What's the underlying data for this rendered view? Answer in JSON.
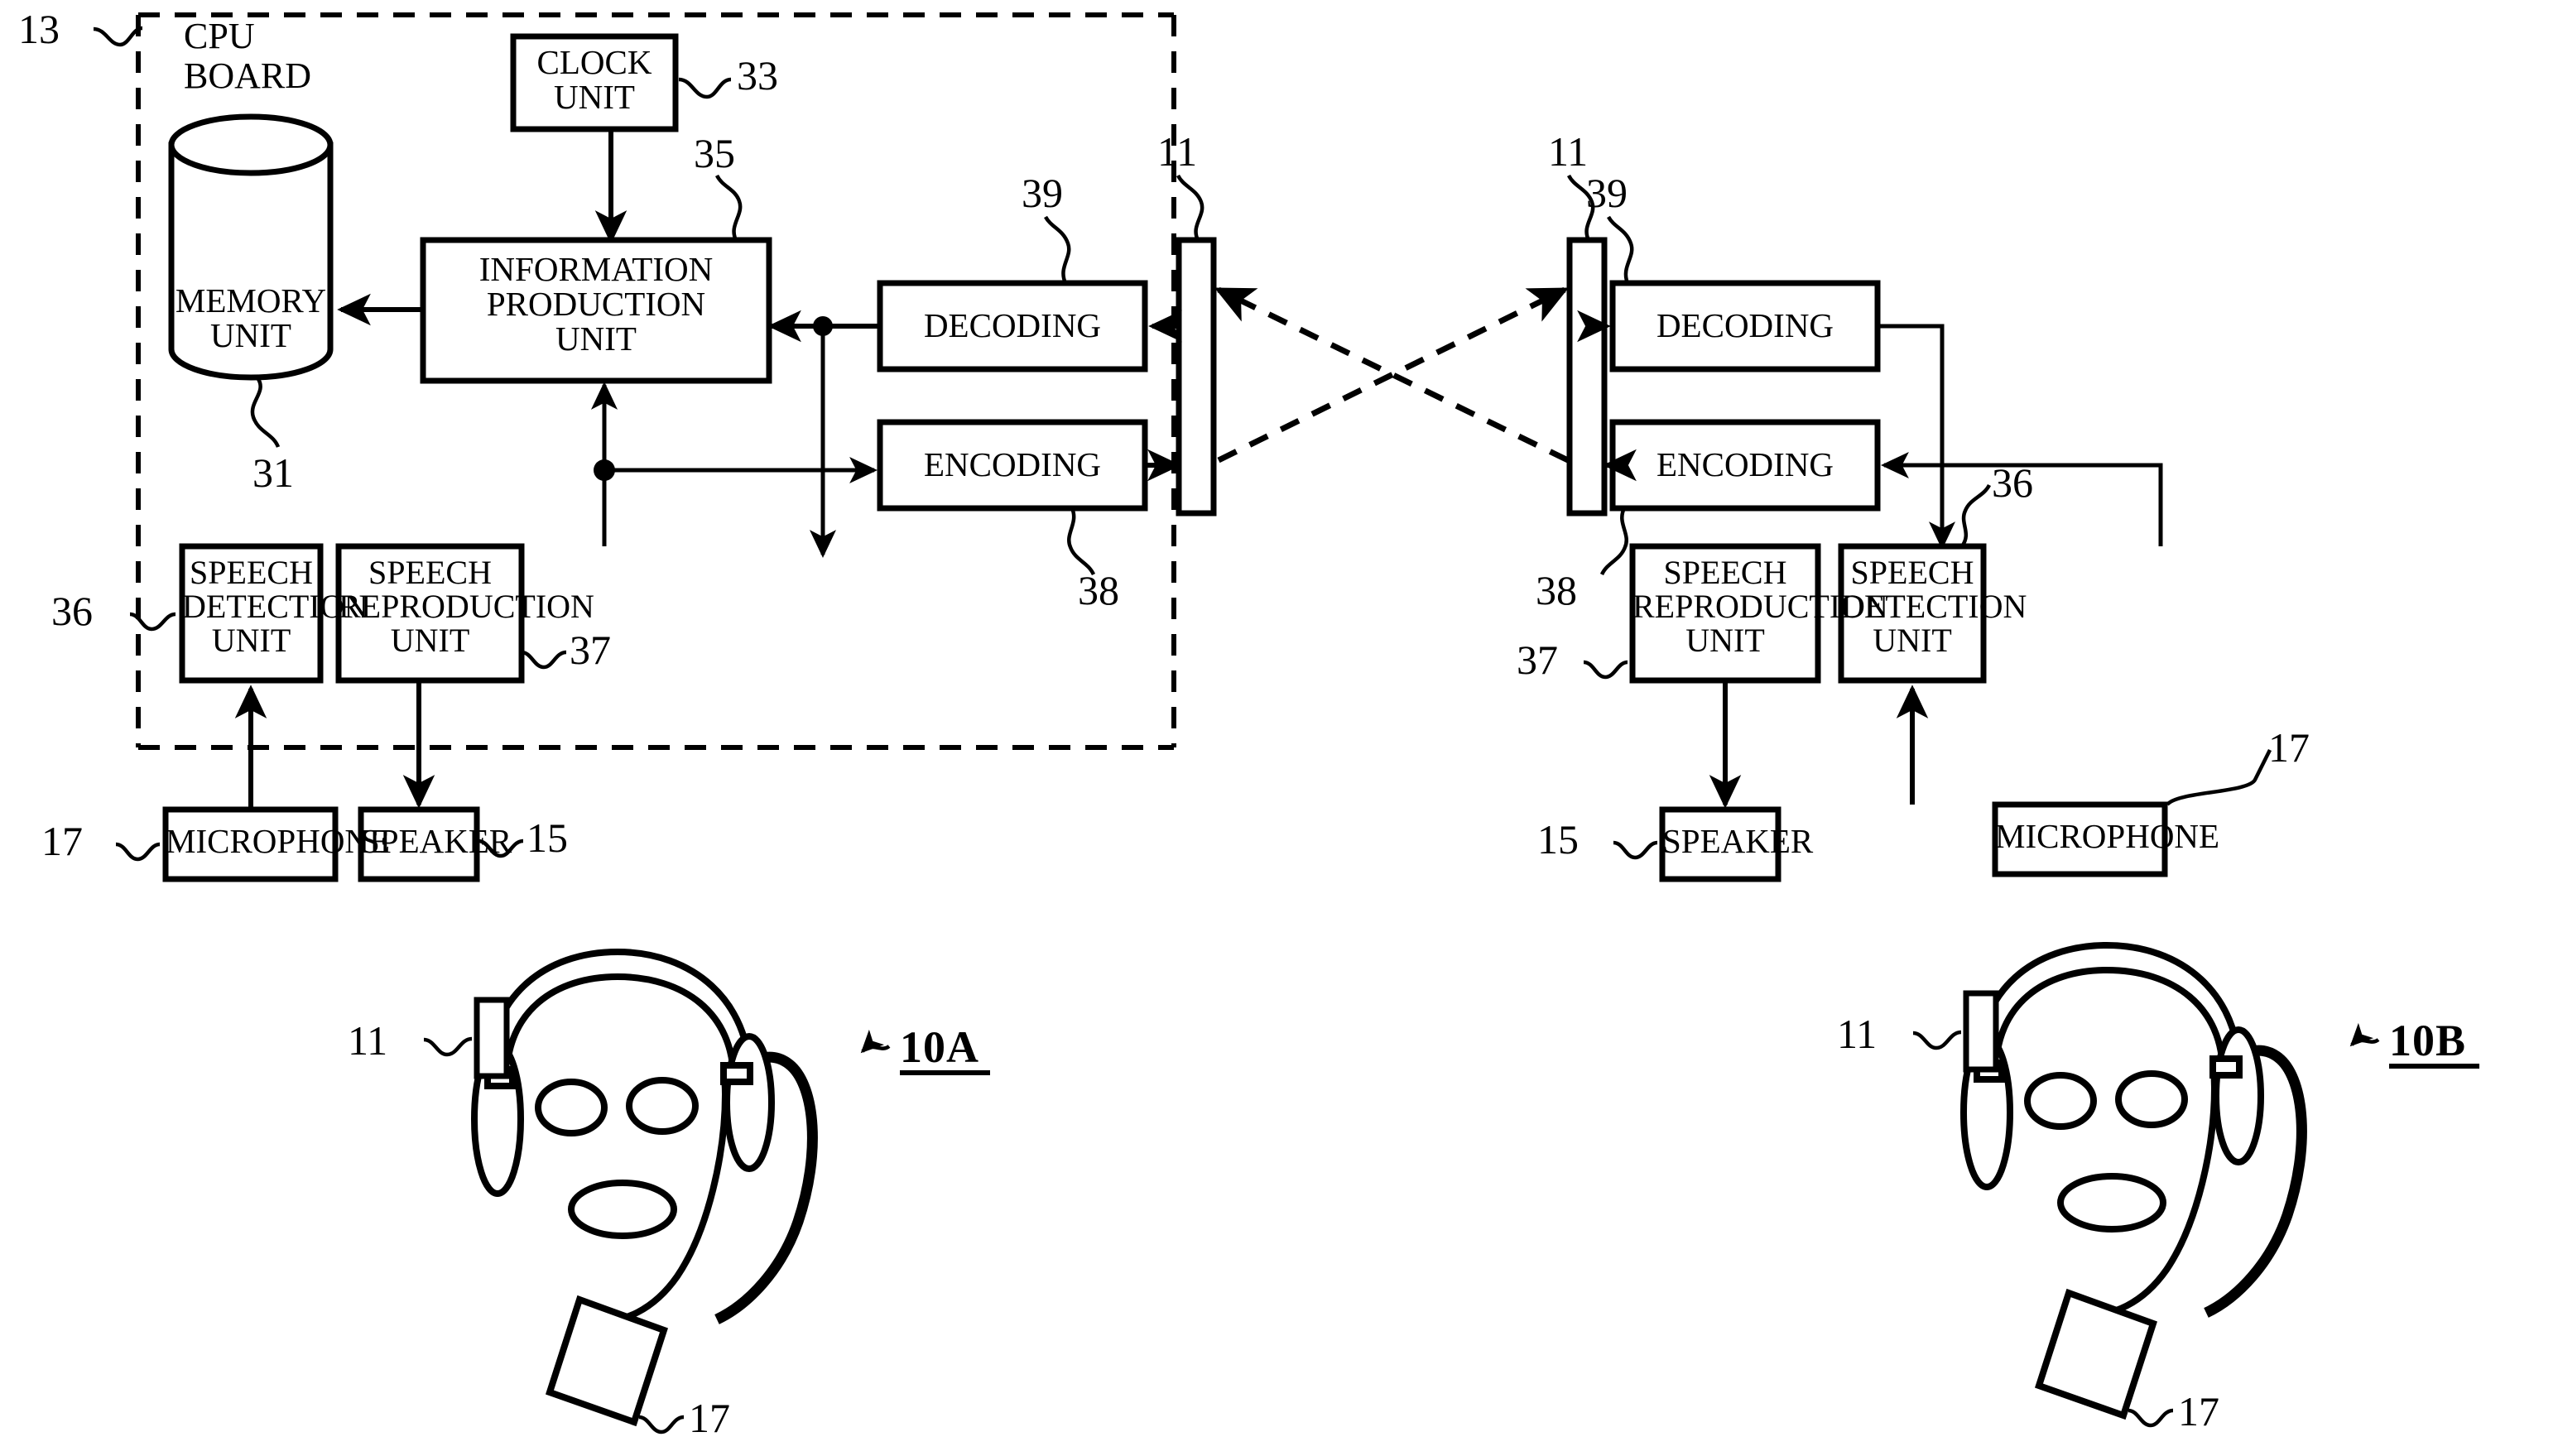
{
  "figure": {
    "type": "patent-block-diagram",
    "description": "Speech communication system block diagram with two headset terminals 10A and 10B"
  },
  "cpu_board": {
    "label_line1": "CPU",
    "label_line2": "BOARD",
    "ref": "13"
  },
  "left_unit": {
    "blocks": {
      "clock": {
        "label": "CLOCK\nUNIT",
        "ref": "33"
      },
      "memory": {
        "label": "MEMORY\nUNIT",
        "ref": "31"
      },
      "info_production": {
        "label": "INFORMATION\nPRODUCTION\nUNIT",
        "ref": "35"
      },
      "decoding": {
        "label": "DECODING",
        "ref": "39"
      },
      "encoding": {
        "label": "ENCODING",
        "ref": "38"
      },
      "speech_detection": {
        "label": "SPEECH\nDETECTION\nUNIT",
        "ref": "36"
      },
      "speech_reproduction": {
        "label": "SPEECH\nREPRODUCTION\nUNIT",
        "ref": "37"
      },
      "microphone": {
        "label": "MICROPHONE",
        "ref": "17"
      },
      "speaker": {
        "label": "SPEAKER",
        "ref": "15"
      },
      "antenna": {
        "ref": "11"
      }
    },
    "headset": {
      "ref": "10A",
      "antenna_ref": "11",
      "mic_ref": "17"
    }
  },
  "right_unit": {
    "blocks": {
      "decoding": {
        "label": "DECODING",
        "ref": "39"
      },
      "encoding": {
        "label": "ENCODING",
        "ref": "38"
      },
      "speech_reproduction": {
        "label": "SPEECH\nREPRODUCTION\nUNIT",
        "ref": "37"
      },
      "speech_detection": {
        "label": "SPEECH\nDETECTION\nUNIT",
        "ref": "36"
      },
      "speaker": {
        "label": "SPEAKER",
        "ref": "15"
      },
      "microphone": {
        "label": "MICROPHONE",
        "ref": "17"
      },
      "antenna": {
        "ref": "11"
      }
    },
    "headset": {
      "ref": "10B",
      "antenna_ref": "11",
      "mic_ref": "17"
    }
  },
  "colors": {
    "ink": "#000000",
    "paper": "#ffffff"
  }
}
